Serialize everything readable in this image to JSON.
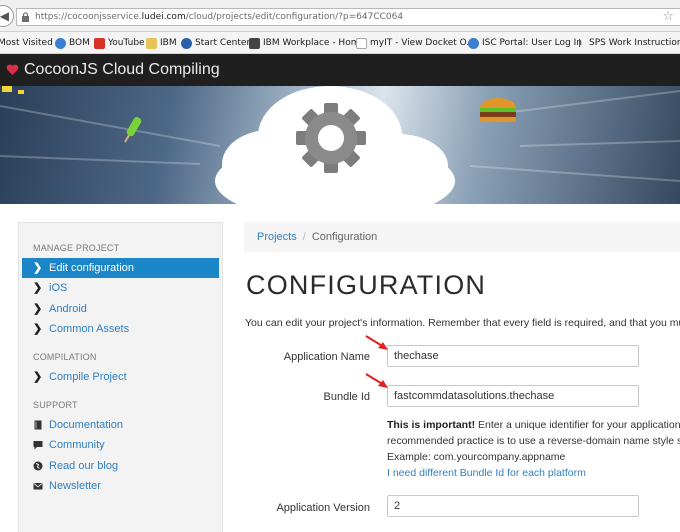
{
  "browser": {
    "url_prefix": "https://cocoonjsservice.",
    "url_host": "ludei.com",
    "url_path": "/cloud/projects/edit/configuration/?p=647CC064",
    "bookmarks": [
      {
        "label": "Most Visited",
        "icon": "gear-icon",
        "color": "#8a8a8a"
      },
      {
        "label": "BOM",
        "icon": "globe-icon",
        "color": "#3b7fd0"
      },
      {
        "label": "YouTube",
        "icon": "youtube-icon",
        "color": "#d9302a"
      },
      {
        "label": "IBM",
        "icon": "folder-icon",
        "color": "#e7c45a"
      },
      {
        "label": "Start Center",
        "icon": "globe-icon",
        "color": "#2a5fa8"
      },
      {
        "label": "IBM Workplace - Home",
        "icon": "w3-icon",
        "color": "#444444"
      },
      {
        "label": "myIT - View Docket O...",
        "icon": "page-icon",
        "color": "#cccccc"
      },
      {
        "label": "ISC Portal: User Log In",
        "icon": "globe-icon",
        "color": "#3b7fd0"
      },
      {
        "label": "SPS Work Instructions...",
        "icon": "cursor-icon",
        "color": "#555555"
      }
    ]
  },
  "header": {
    "title": "CocoonJS Cloud Compiling",
    "accent": "#d9304a"
  },
  "sidebar": {
    "sections": [
      {
        "heading": "MANAGE PROJECT",
        "items": [
          {
            "label": "Edit configuration",
            "icon": "chevron-right-icon",
            "active": true
          },
          {
            "label": "iOS",
            "icon": "chevron-right-icon"
          },
          {
            "label": "Android",
            "icon": "chevron-right-icon"
          },
          {
            "label": "Common Assets",
            "icon": "chevron-right-icon"
          }
        ]
      },
      {
        "heading": "COMPILATION",
        "items": [
          {
            "label": "Compile Project",
            "icon": "chevron-right-icon"
          }
        ]
      },
      {
        "heading": "SUPPORT",
        "items": [
          {
            "label": "Documentation",
            "icon": "book-icon"
          },
          {
            "label": "Community",
            "icon": "chat-icon"
          },
          {
            "label": "Read our blog",
            "icon": "globe-icon"
          },
          {
            "label": "Newsletter",
            "icon": "mail-icon"
          }
        ]
      }
    ]
  },
  "breadcrumb": {
    "link": "Projects",
    "separator": "/",
    "current": "Configuration"
  },
  "main": {
    "title": "CONFIGURATION",
    "intro": "You can edit your project's information. Remember that every field is required, and that you must"
  },
  "form": {
    "app_name": {
      "label": "Application Name",
      "value": "thechase"
    },
    "bundle_id": {
      "label": "Bundle Id",
      "value": "fastcommdatasolutions.thechase"
    },
    "help": {
      "important": "This is important!",
      "line1_rest": " Enter a unique identifier for your application. I",
      "line2": "recommended practice is to use a reverse-domain name style str",
      "line3": "Example: com.yourcompany.appname",
      "link": "I need different Bundle Id for each platform"
    },
    "app_version": {
      "label": "Application Version",
      "value": "2"
    }
  },
  "colors": {
    "link": "#2f7fc1",
    "active": "#1a86c8",
    "arrow": "#e02020"
  }
}
